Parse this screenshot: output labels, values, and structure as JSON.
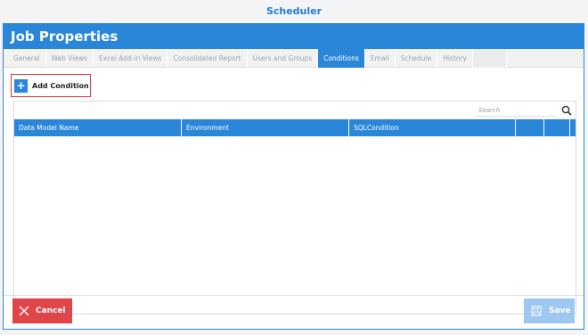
{
  "app": {
    "title": "Scheduler"
  },
  "dialog": {
    "title": "Job Properties"
  },
  "tabs": [
    {
      "label": "General",
      "active": false
    },
    {
      "label": "Web Views",
      "active": false
    },
    {
      "label": "Excel Add-in Views",
      "active": false
    },
    {
      "label": "Consolidated Report",
      "active": false
    },
    {
      "label": "Users and Groups",
      "active": false
    },
    {
      "label": "Conditions",
      "active": true
    },
    {
      "label": "Email",
      "active": false
    },
    {
      "label": "Schedule",
      "active": false
    },
    {
      "label": "History",
      "active": false
    }
  ],
  "toolbar": {
    "add_label": "Add Condition",
    "add_icon": "plus-icon"
  },
  "grid": {
    "search_placeholder": "Search",
    "columns": [
      "Data Model Name",
      "Environment",
      "SQLCondition",
      "",
      "",
      ""
    ],
    "rows": []
  },
  "footer": {
    "cancel_label": "Cancel",
    "save_label": "Save"
  },
  "colors": {
    "accent": "#2a86d8",
    "danger": "#e0454a",
    "disabled_save": "#9ec8ef"
  }
}
